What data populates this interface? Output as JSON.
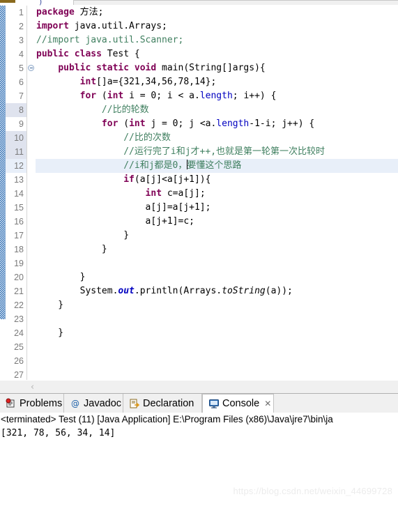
{
  "window": {
    "top_tab_strip_visible": true
  },
  "editor": {
    "first_visible_line": 1,
    "current_line": 12,
    "highlighted_gutter_lines": [
      8,
      10,
      11,
      12
    ],
    "fold_marker_line": 5,
    "colors": {
      "keyword": "#7F0055",
      "comment": "#3F7F5F",
      "field": "#0000C0",
      "static_field": "#0000C0",
      "background": "#FFFFFF",
      "current_line": "#E8EFF9",
      "gutter_text": "#7A7A7A",
      "annotation_ruler": "#2F6FB5"
    },
    "line_numbers": [
      1,
      2,
      3,
      4,
      5,
      6,
      7,
      8,
      9,
      10,
      11,
      12,
      13,
      14,
      15,
      16,
      17,
      18,
      19,
      20,
      21,
      22,
      23,
      24,
      25,
      26,
      27
    ],
    "lines": [
      {
        "n": 1,
        "tokens": [
          {
            "t": "kw",
            "s": "package"
          },
          {
            "t": "pln",
            "s": " 方法;"
          }
        ]
      },
      {
        "n": 2,
        "tokens": [
          {
            "t": "kw",
            "s": "import"
          },
          {
            "t": "pln",
            "s": " java.util.Arrays;"
          }
        ]
      },
      {
        "n": 3,
        "tokens": [
          {
            "t": "cmt",
            "s": "//import java.util.Scanner;"
          }
        ]
      },
      {
        "n": 4,
        "tokens": [
          {
            "t": "kw",
            "s": "public class"
          },
          {
            "t": "pln",
            "s": " Test {"
          }
        ]
      },
      {
        "n": 5,
        "tokens": [
          {
            "t": "pln",
            "s": "    "
          },
          {
            "t": "kw",
            "s": "public static void"
          },
          {
            "t": "pln",
            "s": " main(String[]args){"
          }
        ]
      },
      {
        "n": 6,
        "tokens": [
          {
            "t": "pln",
            "s": "        "
          },
          {
            "t": "kw",
            "s": "int"
          },
          {
            "t": "pln",
            "s": "[]a={321,34,56,78,14};"
          }
        ]
      },
      {
        "n": 7,
        "tokens": [
          {
            "t": "pln",
            "s": "        "
          },
          {
            "t": "kw",
            "s": "for"
          },
          {
            "t": "pln",
            "s": " ("
          },
          {
            "t": "kw",
            "s": "int"
          },
          {
            "t": "pln",
            "s": " i = 0; i < a."
          },
          {
            "t": "fld",
            "s": "length"
          },
          {
            "t": "pln",
            "s": "; i++) {"
          }
        ]
      },
      {
        "n": 8,
        "tokens": [
          {
            "t": "pln",
            "s": "            "
          },
          {
            "t": "cmt",
            "s": "//比的轮数"
          }
        ]
      },
      {
        "n": 9,
        "tokens": [
          {
            "t": "pln",
            "s": "            "
          },
          {
            "t": "kw",
            "s": "for"
          },
          {
            "t": "pln",
            "s": " ("
          },
          {
            "t": "kw",
            "s": "int"
          },
          {
            "t": "pln",
            "s": " j = 0; j <a."
          },
          {
            "t": "fld",
            "s": "length"
          },
          {
            "t": "pln",
            "s": "-1-i; j++) {"
          }
        ]
      },
      {
        "n": 10,
        "tokens": [
          {
            "t": "pln",
            "s": "                "
          },
          {
            "t": "cmt",
            "s": "//比的次数"
          }
        ]
      },
      {
        "n": 11,
        "tokens": [
          {
            "t": "pln",
            "s": "                "
          },
          {
            "t": "cmt",
            "s": "//运行完了i和j才++,也就是第一轮第一次比较时"
          }
        ]
      },
      {
        "n": 12,
        "tokens": [
          {
            "t": "pln",
            "s": "                "
          },
          {
            "t": "cmt",
            "s": "//i和j都是0，"
          },
          {
            "t": "caret",
            "s": ""
          },
          {
            "t": "cmt",
            "s": "要懂这个思路"
          }
        ]
      },
      {
        "n": 13,
        "tokens": [
          {
            "t": "pln",
            "s": "                "
          },
          {
            "t": "kw",
            "s": "if"
          },
          {
            "t": "pln",
            "s": "(a[j]<a[j+1]){"
          }
        ]
      },
      {
        "n": 14,
        "tokens": [
          {
            "t": "pln",
            "s": "                    "
          },
          {
            "t": "kw",
            "s": "int"
          },
          {
            "t": "pln",
            "s": " c=a[j];"
          }
        ]
      },
      {
        "n": 15,
        "tokens": [
          {
            "t": "pln",
            "s": "                    a[j]=a[j+1];"
          }
        ]
      },
      {
        "n": 16,
        "tokens": [
          {
            "t": "pln",
            "s": "                    a[j+1]=c;"
          }
        ]
      },
      {
        "n": 17,
        "tokens": [
          {
            "t": "pln",
            "s": "                }"
          }
        ]
      },
      {
        "n": 18,
        "tokens": [
          {
            "t": "pln",
            "s": "            }"
          }
        ]
      },
      {
        "n": 19,
        "tokens": []
      },
      {
        "n": 20,
        "tokens": [
          {
            "t": "pln",
            "s": "        }"
          }
        ]
      },
      {
        "n": 21,
        "tokens": [
          {
            "t": "pln",
            "s": "        System."
          },
          {
            "t": "stat",
            "s": "out"
          },
          {
            "t": "pln",
            "s": ".println(Arrays."
          },
          {
            "t": "mth",
            "s": "toString"
          },
          {
            "t": "pln",
            "s": "(a));"
          }
        ]
      },
      {
        "n": 22,
        "tokens": [
          {
            "t": "pln",
            "s": "    }"
          }
        ]
      },
      {
        "n": 23,
        "tokens": []
      },
      {
        "n": 24,
        "tokens": [
          {
            "t": "pln",
            "s": "    }"
          }
        ]
      },
      {
        "n": 25,
        "tokens": []
      },
      {
        "n": 26,
        "tokens": []
      },
      {
        "n": 27,
        "tokens": []
      }
    ]
  },
  "scrollbar": {
    "left_arrow_glyph": "‹"
  },
  "bottom_view": {
    "tabs": [
      {
        "label": "Problems",
        "icon": "problems-icon",
        "active": false,
        "closable": false
      },
      {
        "label": "Javadoc",
        "icon": "javadoc-icon",
        "active": false,
        "closable": false
      },
      {
        "label": "Declaration",
        "icon": "declaration-icon",
        "active": false,
        "closable": false
      },
      {
        "label": "Console",
        "icon": "console-icon",
        "active": true,
        "closable": true,
        "close_glyph": "✕"
      }
    ],
    "console": {
      "header": "<terminated> Test (11) [Java Application] E:\\Program Files (x86)\\Java\\jre7\\bin\\ja",
      "output": [
        "[321, 78, 56, 34, 14]"
      ]
    }
  },
  "watermark": {
    "text": "https://blog.csdn.net/weixin_44699728"
  }
}
